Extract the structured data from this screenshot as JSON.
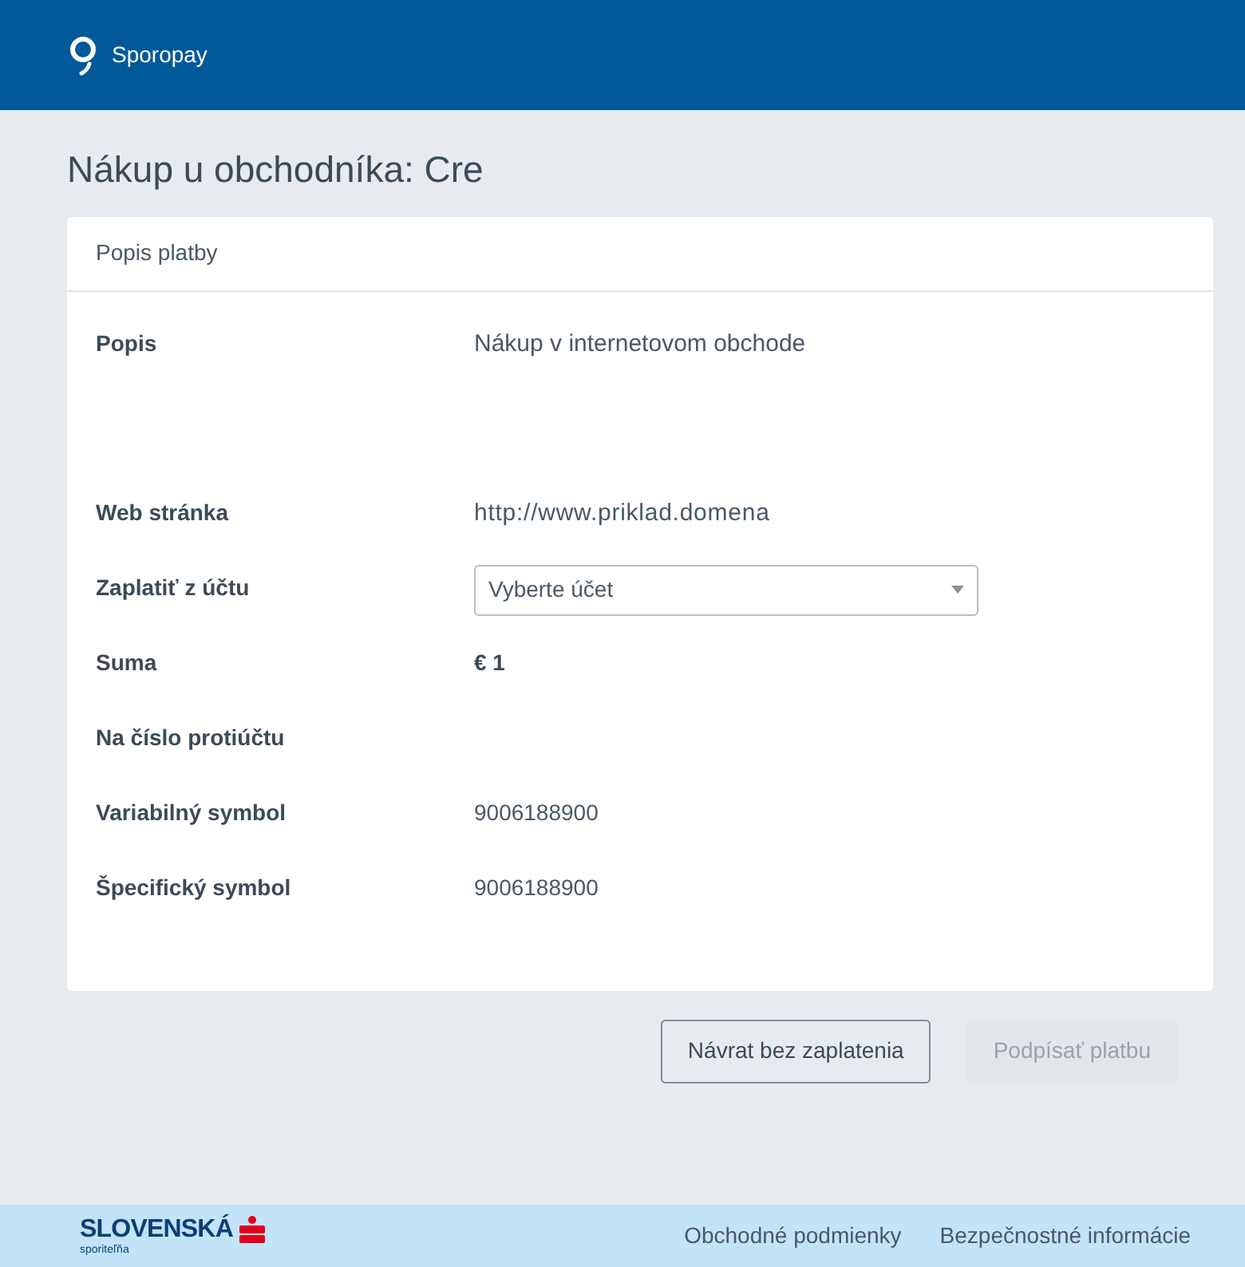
{
  "header": {
    "brand": "Sporopay"
  },
  "title": "Nákup u obchodníka: Cre",
  "card": {
    "heading": "Popis platby",
    "rows": [
      {
        "kind": "description",
        "label": "Popis",
        "value": "Nákup v internetovom obchode"
      },
      {
        "kind": "link",
        "label": "Web stránka",
        "value": "http://www.priklad.domena"
      },
      {
        "kind": "select",
        "label": "Zaplatiť z účtu",
        "placeholder": "Vyberte účet"
      },
      {
        "kind": "amount",
        "label": "Suma",
        "value": "€ 1"
      },
      {
        "kind": "text",
        "label": "Na číslo protiúčtu"
      },
      {
        "kind": "text",
        "label": "Variabilný symbol",
        "value": "9006188900"
      },
      {
        "kind": "text",
        "label": "Špecifický symbol",
        "value": "9006188900"
      }
    ]
  },
  "buttons": [
    {
      "label": "Návrat bez zaplatenia",
      "disabled": false
    },
    {
      "label": "Podpísať platbu",
      "disabled": true
    }
  ],
  "footer": {
    "logo_main": "SLOVENSKÁ",
    "logo_sub": "sporiteľňa",
    "links": [
      "Obchodné podmienky",
      "Bezpečnostné informácie"
    ]
  }
}
